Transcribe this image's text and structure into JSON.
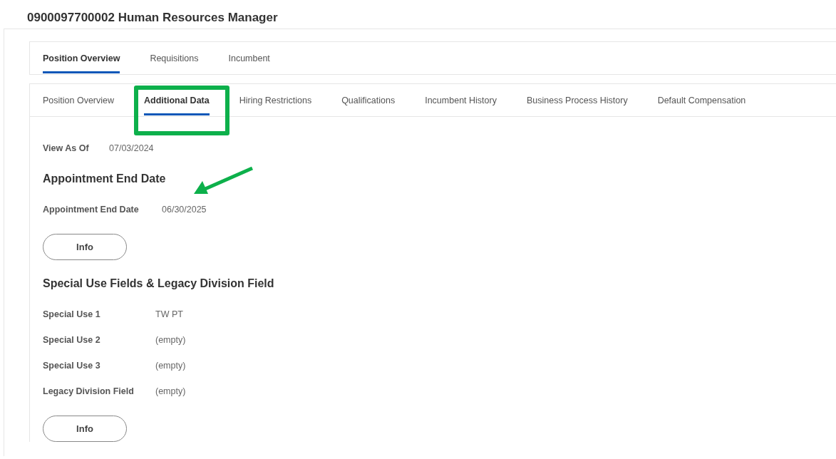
{
  "page_title": "0900097700002 Human Resources Manager",
  "tabs": [
    {
      "label": "Position Overview",
      "selected": true
    },
    {
      "label": "Requisitions",
      "selected": false
    },
    {
      "label": "Incumbent",
      "selected": false
    }
  ],
  "subtabs": [
    {
      "label": "Position Overview",
      "selected": false
    },
    {
      "label": "Additional Data",
      "selected": true
    },
    {
      "label": "Hiring Restrictions",
      "selected": false
    },
    {
      "label": "Qualifications",
      "selected": false
    },
    {
      "label": "Incumbent History",
      "selected": false
    },
    {
      "label": "Business Process History",
      "selected": false
    },
    {
      "label": "Default Compensation",
      "selected": false
    }
  ],
  "view_as_of": {
    "label": "View As Of",
    "value": "07/03/2024"
  },
  "sections": [
    {
      "heading": "Appointment End Date",
      "fields": [
        {
          "label": "Appointment End Date",
          "value": "06/30/2025"
        }
      ],
      "button": "Info"
    },
    {
      "heading": "Special Use Fields & Legacy Division Field",
      "fields": [
        {
          "label": "Special Use 1",
          "value": "TW PT"
        },
        {
          "label": "Special Use 2",
          "value": "(empty)"
        },
        {
          "label": "Special Use 3",
          "value": "(empty)"
        },
        {
          "label": "Legacy Division Field",
          "value": "(empty)"
        }
      ],
      "button": "Info"
    }
  ]
}
